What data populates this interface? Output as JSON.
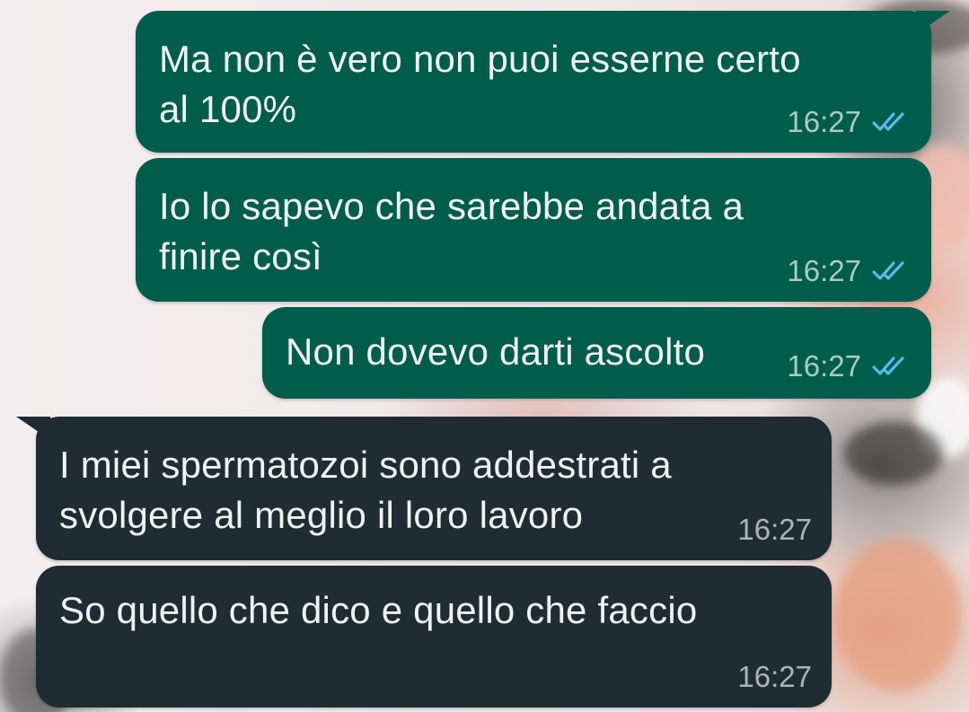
{
  "messages": [
    {
      "direction": "outgoing",
      "text": "Ma non è vero non puoi esserne certo\nal 100%",
      "time": "16:27",
      "status_icon": "double-check-read-icon"
    },
    {
      "direction": "outgoing",
      "text": "Io lo sapevo che sarebbe andata a\nfinire così",
      "time": "16:27",
      "status_icon": "double-check-read-icon"
    },
    {
      "direction": "outgoing",
      "text": "Non dovevo darti ascolto",
      "time": "16:27",
      "status_icon": "double-check-read-icon"
    },
    {
      "direction": "incoming",
      "text": "I miei spermatozoi sono addestrati a\nsvolgere al meglio il loro lavoro",
      "time": "16:27"
    },
    {
      "direction": "incoming",
      "text": "So quello che dico e quello che faccio",
      "time": "16:27"
    }
  ],
  "colors": {
    "outgoing_bubble": "#005c4b",
    "incoming_bubble": "#1f2c34",
    "read_tick": "#53bdeb"
  }
}
